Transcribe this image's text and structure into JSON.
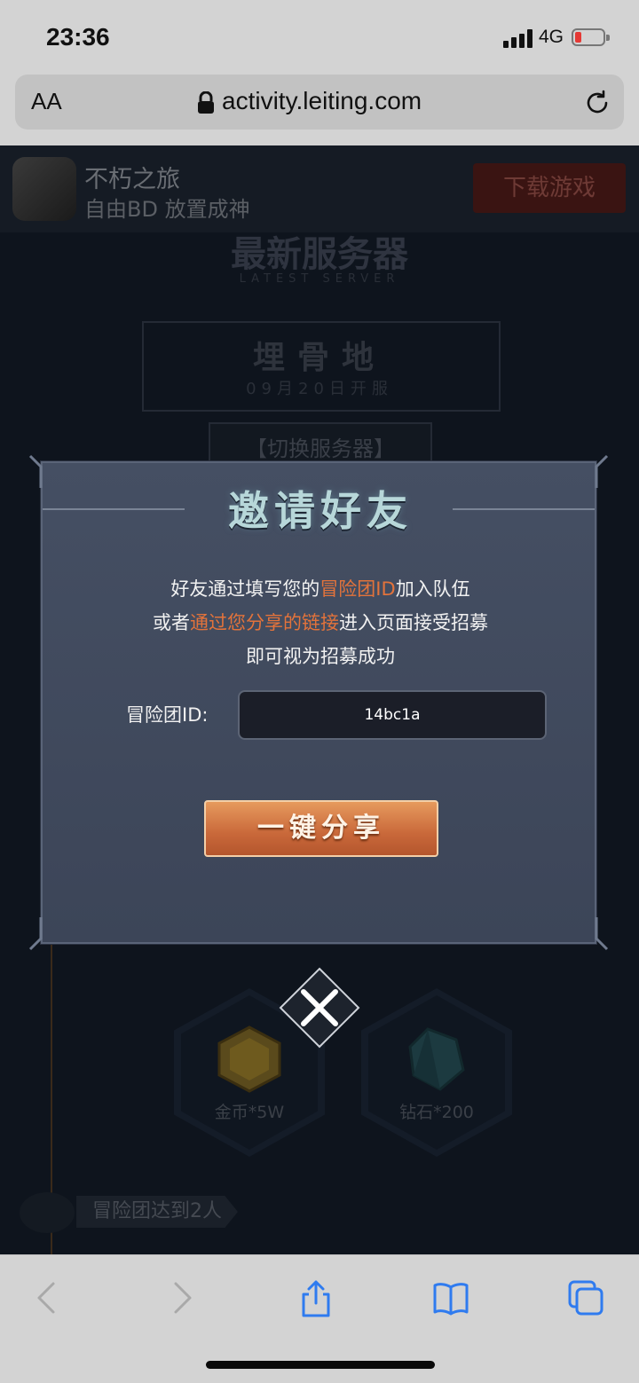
{
  "status_bar": {
    "time": "23:36",
    "network": "4G"
  },
  "browser": {
    "text_size_label": "AA",
    "url": "activity.leiting.com"
  },
  "banner": {
    "app_name": "不朽之旅",
    "app_tagline": "自由BD 放置成神",
    "download_label": "下载游戏"
  },
  "page": {
    "section_title": "最新服务器",
    "section_title_en": "LATEST SERVER",
    "server_name": "埋骨地",
    "server_open_date": "09月20日开服",
    "switch_server_label": "【切换服务器】",
    "rewards": [
      {
        "label": "金币*5W",
        "icon": "gold-coin-icon"
      },
      {
        "label": "钻石*200",
        "icon": "diamond-icon"
      }
    ],
    "milestone_label": "冒险团达到2人"
  },
  "modal": {
    "title": "邀请好友",
    "line1_pre": "好友通过填写您的",
    "line1_hl": "冒险团ID",
    "line1_post": "加入队伍",
    "line2_pre": "或者",
    "line2_hl": "通过您分享的链接",
    "line2_post": "进入页面接受招募",
    "line3": "即可视为招募成功",
    "id_label": "冒险团ID:",
    "id_value": "14bc1a",
    "share_label": "一键分享",
    "highlight_color": "#e3733b"
  }
}
